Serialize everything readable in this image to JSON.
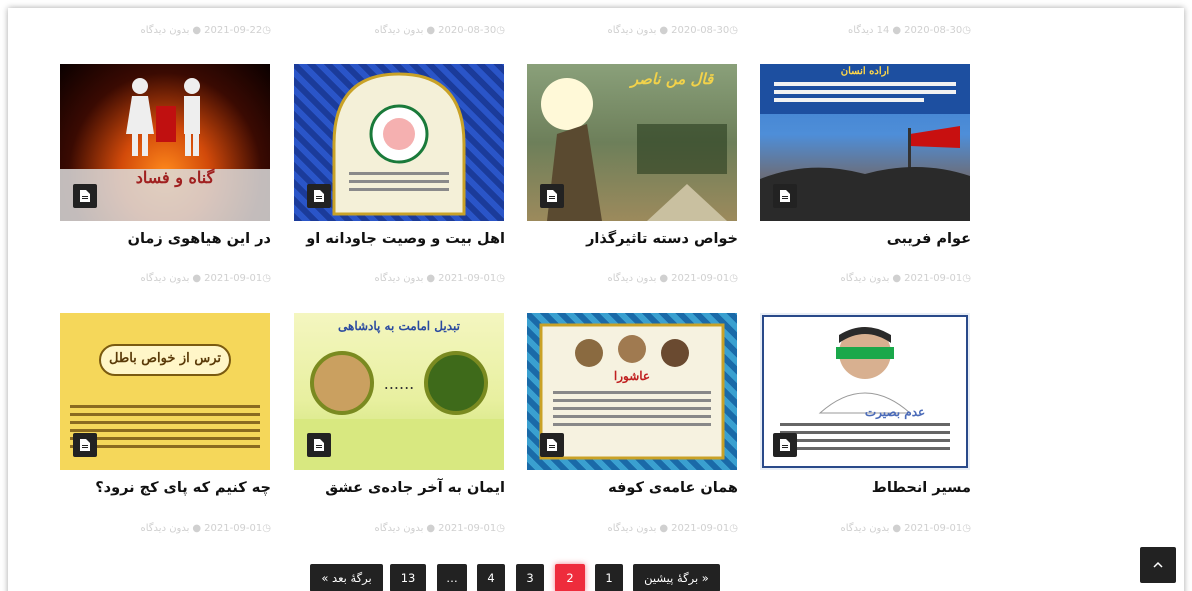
{
  "top_meta": [
    {
      "date": "2021-09-22",
      "comments": "بدون دیدگاه"
    },
    {
      "date": "2020-08-30",
      "comments": "بدون دیدگاه"
    },
    {
      "date": "2020-08-30",
      "comments": "بدون دیدگاه"
    },
    {
      "date": "2020-08-30",
      "comments": "14 دیدگاه"
    }
  ],
  "posts_row1": [
    {
      "title": "در این هیاهوی زمان",
      "image_caption": "گناه و فساد",
      "date": "2021-09-01",
      "comments": "بدون دیدگاه"
    },
    {
      "title": "اهل بیت و وصیت جاودانه او",
      "image_caption": "",
      "date": "2021-09-01",
      "comments": "بدون دیدگاه"
    },
    {
      "title": "خواص دسته تاثیرگذار",
      "image_caption": "قال من ناصر",
      "date": "2021-09-01",
      "comments": "بدون دیدگاه"
    },
    {
      "title": "عوام فریبی",
      "image_caption": "اراده انسان",
      "date": "2021-09-01",
      "comments": "بدون دیدگاه"
    }
  ],
  "posts_row2": [
    {
      "title": "چه کنیم که پای کج نرود؟",
      "image_caption": "ترس از خواص باطل",
      "date": "2021-09-01",
      "comments": "بدون دیدگاه"
    },
    {
      "title": "ایمان به آخر جاده‌ی عشق",
      "image_caption": "تبدیل امامت به پادشاهی",
      "date": "2021-09-01",
      "comments": "بدون دیدگاه"
    },
    {
      "title": "همان عامه‌ی کوفه",
      "image_caption": "عاشورا",
      "date": "2021-09-01",
      "comments": "بدون دیدگاه"
    },
    {
      "title": "مسیر انحطاط",
      "image_caption": "عدم بصیرت",
      "date": "2021-09-01",
      "comments": "بدون دیدگاه"
    }
  ],
  "pagination": {
    "next": "برگهٔ بعد »",
    "last": "13",
    "dots": "…",
    "p4": "4",
    "p3": "3",
    "p2": "2",
    "p1": "1",
    "prev": "« برگهٔ پیشین",
    "current": 2
  },
  "colors": {
    "accent": "#ee2c3c",
    "button": "#222222",
    "meta": "#d0d0d0"
  },
  "icons": {
    "badge": "document-icon",
    "scroll": "chevron-up-icon",
    "comment": "comment-icon",
    "clock": "clock-icon"
  }
}
